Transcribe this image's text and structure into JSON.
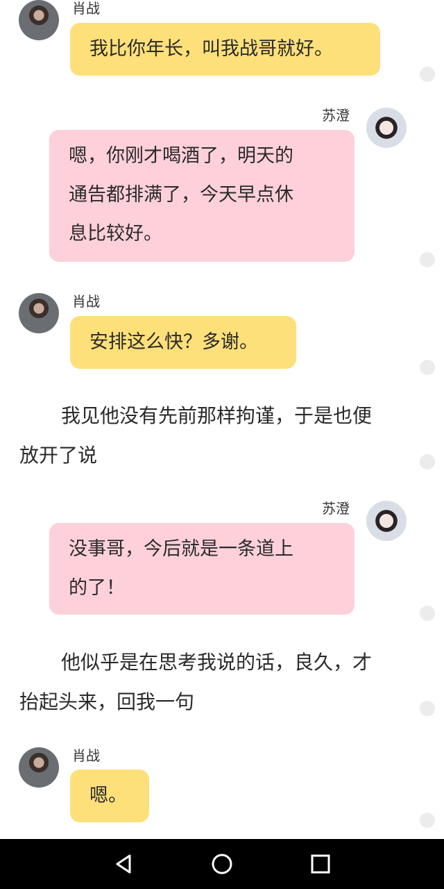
{
  "speakers": {
    "male": "肖战",
    "female": "苏澄"
  },
  "messages": [
    {
      "speaker": "肖战",
      "text": "我比你年长，叫我战哥就好。"
    },
    {
      "speaker": "苏澄",
      "lines": [
        "嗯，你刚才喝酒了，明天的",
        "通告都排满了，今天早点休",
        "息比较好。"
      ]
    },
    {
      "speaker": "肖战",
      "text": "安排这么快？多谢。"
    },
    {
      "narration": [
        "我见他没有先前那样拘谨，于是也便",
        "放开了说"
      ]
    },
    {
      "speaker": "苏澄",
      "lines": [
        "没事哥，今后就是一条道上",
        "的了！"
      ]
    },
    {
      "narration": [
        "他似乎是在思考我说的话，良久，才",
        "抬起头来，回我一句"
      ]
    },
    {
      "speaker": "肖战",
      "text": "嗯。"
    }
  ],
  "colors": {
    "male_bubble": "#fde07a",
    "female_bubble": "#fdd0da",
    "navbar": "#000000"
  },
  "navbar": {
    "icons": [
      "back-icon",
      "home-icon",
      "recents-icon"
    ]
  }
}
